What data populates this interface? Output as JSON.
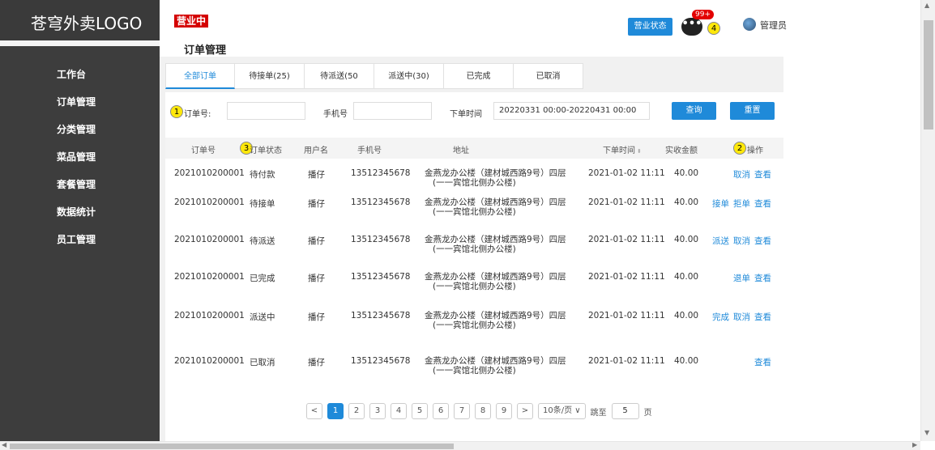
{
  "sidebar": {
    "logo": "苍穹外卖LOGO",
    "items": [
      {
        "label": "工作台"
      },
      {
        "label": "订单管理"
      },
      {
        "label": "分类管理"
      },
      {
        "label": "菜品管理"
      },
      {
        "label": "套餐管理"
      },
      {
        "label": "数据统计"
      },
      {
        "label": "员工管理"
      }
    ]
  },
  "header": {
    "biz_badge": "营业中",
    "page_title": "订单管理",
    "status_button": "营业状态",
    "msg_icon_text": "•••",
    "msg_badge": "99+",
    "admin": "管理员"
  },
  "markers": [
    "1",
    "2",
    "3",
    "4"
  ],
  "tabs": [
    {
      "label": "全部订单"
    },
    {
      "label": "待接单(25)"
    },
    {
      "label": "待派送(50"
    },
    {
      "label": "派送中(30)"
    },
    {
      "label": "已完成"
    },
    {
      "label": "已取消"
    }
  ],
  "filters": {
    "order_no_label": "订单号:",
    "phone_label": "手机号",
    "time_label": "下单时间",
    "time_value": "20220331 00:00-20220431 00:00",
    "search_button": "查询",
    "reset_button": "重置"
  },
  "table": {
    "headers": [
      "订单号",
      "订单状态",
      "用户名",
      "手机号",
      "地址",
      "下单时间",
      "实收金额",
      "操作"
    ],
    "sort_icon": "⬍",
    "rows": [
      {
        "order_no": "2021010200001",
        "status": "待付款",
        "user": "播仔",
        "phone": "13512345678",
        "addr1": "金燕龙办公楼（建材城西路9号）四层",
        "addr2": "(一一宾馆北侧办公楼)",
        "time": "2021-01-02 11:11",
        "amount": "40.00",
        "ops": [
          "取消",
          "查看"
        ]
      },
      {
        "order_no": "2021010200001",
        "status": "待接单",
        "user": "播仔",
        "phone": "13512345678",
        "addr1": "金燕龙办公楼（建材城西路9号）四层",
        "addr2": "(一一宾馆北侧办公楼)",
        "time": "2021-01-02 11:11",
        "amount": "40.00",
        "ops": [
          "接单",
          "拒单",
          "查看"
        ]
      },
      {
        "order_no": "2021010200001",
        "status": "待派送",
        "user": "播仔",
        "phone": "13512345678",
        "addr1": "金燕龙办公楼（建材城西路9号）四层",
        "addr2": "(一一宾馆北侧办公楼)",
        "time": "2021-01-02 11:11",
        "amount": "40.00",
        "ops": [
          "派送",
          "取消",
          "查看"
        ]
      },
      {
        "order_no": "2021010200001",
        "status": "已完成",
        "user": "播仔",
        "phone": "13512345678",
        "addr1": "金燕龙办公楼（建材城西路9号）四层",
        "addr2": "(一一宾馆北侧办公楼)",
        "time": "2021-01-02 11:11",
        "amount": "40.00",
        "ops": [
          "退单",
          "查看"
        ]
      },
      {
        "order_no": "2021010200001",
        "status": "派送中",
        "user": "播仔",
        "phone": "13512345678",
        "addr1": "金燕龙办公楼（建材城西路9号）四层",
        "addr2": "(一一宾馆北侧办公楼)",
        "time": "2021-01-02 11:11",
        "amount": "40.00",
        "ops": [
          "完成",
          "取消",
          "查看"
        ]
      },
      {
        "order_no": "2021010200001",
        "status": "已取消",
        "user": "播仔",
        "phone": "13512345678",
        "addr1": "金燕龙办公楼（建材城西路9号）四层",
        "addr2": "(一一宾馆北侧办公楼)",
        "time": "2021-01-02 11:11",
        "amount": "40.00",
        "ops": [
          "查看"
        ]
      }
    ]
  },
  "pagination": {
    "prev": "<",
    "next": ">",
    "pages": [
      "1",
      "2",
      "3",
      "4",
      "5",
      "6",
      "7",
      "8",
      "9"
    ],
    "current": "1",
    "page_size": "10条/页 ∨",
    "jump_label": "跳至",
    "jump_value": "5",
    "page_suffix": "页"
  }
}
